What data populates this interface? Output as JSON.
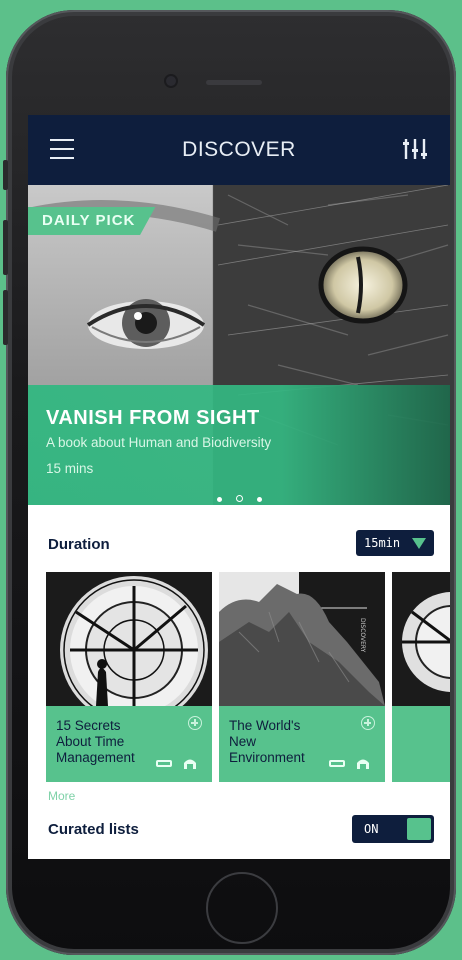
{
  "header": {
    "title": "DISCOVER"
  },
  "hero": {
    "badge": "DAILY PICK",
    "title": "VANISH FROM SIGHT",
    "subtitle": "A book about Human and Biodiversity",
    "duration": "15 mins",
    "active_slide": 2,
    "slide_count": 3
  },
  "duration": {
    "label": "Duration",
    "selected": "15min"
  },
  "cards": [
    {
      "title": "15 Secrets About Time Management"
    },
    {
      "title": "The World's New Environment"
    }
  ],
  "more_link": "More",
  "curated": {
    "label": "Curated lists",
    "toggle_state": "ON"
  },
  "colors": {
    "navy": "#0e1e3d",
    "accent_green": "#57c28d",
    "background": "#5cc08a"
  },
  "icons": [
    "menu-icon",
    "filter-sliders-icon",
    "plus-icon",
    "headphones-icon",
    "book-icon",
    "dropdown-arrow-icon"
  ]
}
